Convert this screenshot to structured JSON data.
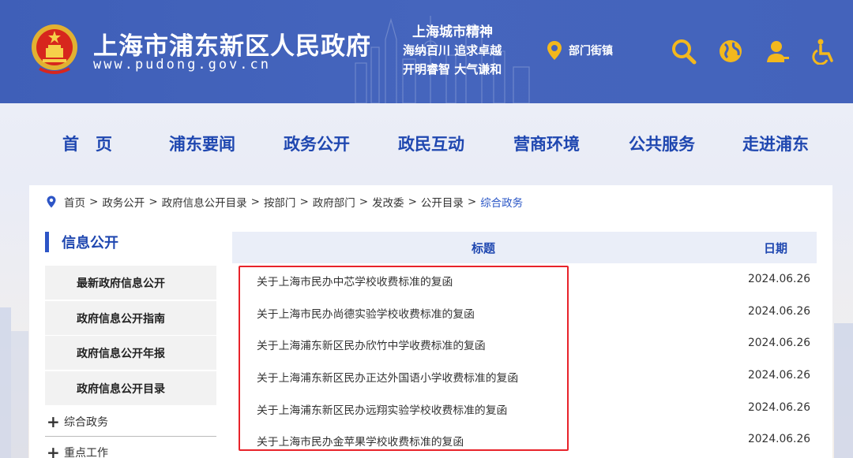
{
  "header": {
    "title": "上海市浦东新区人民政府",
    "url": "www.pudong.gov.cn",
    "spirit_title": "上海城市精神",
    "spirit_line1": "海纳百川  追求卓越",
    "spirit_line2": "开明睿智  大气谦和",
    "dept_link": "部门街镇",
    "icons": [
      "location-pin-icon",
      "search-icon",
      "globe-icon",
      "user-icon",
      "accessibility-icon"
    ],
    "accent_color": "#f3b81d",
    "bg_color": "#4463bb"
  },
  "nav": {
    "items": [
      "首　页",
      "浦东要闻",
      "政务公开",
      "政民互动",
      "营商环境",
      "公共服务",
      "走进浦东"
    ],
    "color": "#1f47b0"
  },
  "breadcrumb": {
    "items": [
      "首页",
      "政务公开",
      "政府信息公开目录",
      "按部门",
      "政府部门",
      "发改委",
      "公开目录"
    ],
    "current": "综合政务",
    "separator": ">"
  },
  "sidebar": {
    "heading": "信息公开",
    "items": [
      "最新政府信息公开",
      "政府信息公开指南",
      "政府信息公开年报",
      "政府信息公开目录"
    ],
    "tree": [
      "综合政务",
      "重点工作"
    ]
  },
  "table": {
    "col_title": "标题",
    "col_date": "日期",
    "rows": [
      {
        "title": "关于上海市民办中芯学校收费标准的复函",
        "date": "2024.06.26"
      },
      {
        "title": "关于上海市民办尚德实验学校收费标准的复函",
        "date": "2024.06.26"
      },
      {
        "title": "关于上海浦东新区民办欣竹中学收费标准的复函",
        "date": "2024.06.26"
      },
      {
        "title": "关于上海浦东新区民办正达外国语小学收费标准的复函",
        "date": "2024.06.26"
      },
      {
        "title": "关于上海浦东新区民办远翔实验学校收费标准的复函",
        "date": "2024.06.26"
      },
      {
        "title": "关于上海市民办金苹果学校收费标准的复函",
        "date": "2024.06.26"
      }
    ]
  },
  "highlight_color": "#e8232a"
}
